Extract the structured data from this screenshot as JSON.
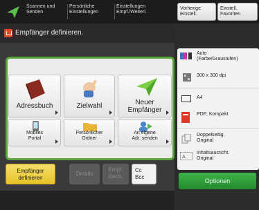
{
  "topbar": {
    "tabs": [
      {
        "line1": "Scannen und",
        "line2": "Senden"
      },
      {
        "line1": "Persönliche",
        "line2": "Einstellungen"
      },
      {
        "line1": "Einstellungen",
        "line2": "Empf./Weiterl."
      }
    ]
  },
  "header": {
    "title": "Empfänger definieren."
  },
  "tiles": {
    "address_book": "Adressbuch",
    "one_touch": "Zielwahl",
    "new_dest_line1": "Neuer",
    "new_dest_line2": "Empfänger",
    "mobile_line1": "Mobiles",
    "mobile_line2": "Portal",
    "personal_line1": "Persönlicher",
    "personal_line2": "Ordner",
    "to_myself_line1": "An eigene",
    "to_myself_line2": "Adr. senden"
  },
  "bottom": {
    "specify_line1": "Empfänger",
    "specify_line2": "definieren",
    "details": "Details",
    "delete_line1": "Empf.",
    "delete_line2": "lösch.",
    "cc_line1": "Cc",
    "cc_line2": "Bcc"
  },
  "right": {
    "prev_settings_line1": "Vorherige",
    "prev_settings_line2": "Einstell.",
    "favorites_line1": "Einstell.",
    "favorites_line2": "Favoriten",
    "color_mode_line1": "Auto",
    "color_mode_line2": "(Farbe/Graustufen)",
    "resolution": "300 x 300 dpi",
    "paper_size": "A4",
    "file_format": "PDF; Kompakt",
    "duplex_line1": "Doppelseitig.",
    "duplex_line2": "Original",
    "content_type_line1": "Inhaltsausricht.",
    "content_type_line2": "Original",
    "options": "Optionen"
  },
  "colors": {
    "accent_green": "#5aa63a",
    "destination_yellow": "#e7c42a",
    "header_red": "#e0492a"
  }
}
